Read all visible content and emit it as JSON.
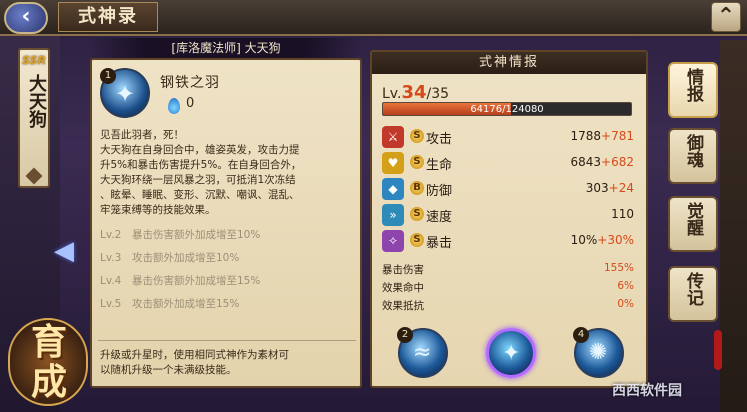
{
  "window": {
    "title": "式神录"
  },
  "nav": {
    "back_icon": "‹",
    "close_icon": "⌃"
  },
  "shikigami": {
    "rarity": "SSR",
    "name": "大天狗",
    "full_title": "[库洛魔法师] 大天狗"
  },
  "skill": {
    "level_badge": "1",
    "name": "钢铁之羽",
    "orb_cost": "0",
    "description": [
      "见吾此羽者，死！",
      "大天狗在自身回合中，雄姿英发，攻击力提",
      "升5%和暴击伤害提升5%。在自身回合外，",
      "大天狗环绕一层风暴之羽，可抵消1次冻结",
      "、眩晕、睡眠、变形、沉默、嘲讽、混乱、",
      "牢笼束缚等的技能效果。"
    ],
    "levels": [
      {
        "tag": "Lv.2",
        "text": "暴击伤害额外加成增至10%"
      },
      {
        "tag": "Lv.3",
        "text": "攻击额外加成增至10%"
      },
      {
        "tag": "Lv.4",
        "text": "暴击伤害额外加成增至15%"
      },
      {
        "tag": "Lv.5",
        "text": "攻击额外加成增至15%"
      }
    ],
    "note": [
      "升级或升星时，使用相同式神作为素材可",
      "以随机升级一个未满级技能。"
    ]
  },
  "info": {
    "header": "式神情报",
    "level_prefix": "Lv.",
    "level_current": "34",
    "level_max": "/35",
    "exp_text": "64176/124080",
    "exp_fraction": 0.517,
    "stats": [
      {
        "name": "攻击",
        "value": "1788",
        "bonus": "+781",
        "color": "#c0392b",
        "icon": "attack-icon"
      },
      {
        "name": "生命",
        "value": "6843",
        "bonus": "+682",
        "color": "#d4a017",
        "icon": "heart-icon"
      },
      {
        "name": "防御",
        "value": "303",
        "bonus": "+24",
        "color": "#2e86c1",
        "icon": "shield-icon"
      },
      {
        "name": "速度",
        "value": "110",
        "bonus": "",
        "color": "#2e8bb8",
        "icon": "boot-icon"
      },
      {
        "name": "暴击",
        "value": "10%",
        "bonus": "+30%",
        "color": "#8e44ad",
        "icon": "crit-icon"
      }
    ],
    "sub_stats": [
      {
        "name": "暴击伤害",
        "value": "155%"
      },
      {
        "name": "效果命中",
        "value": "6%"
      },
      {
        "name": "效果抵抗",
        "value": "0%"
      }
    ],
    "skill_slots": [
      {
        "num": "2",
        "selected": false
      },
      {
        "num": "",
        "selected": true
      },
      {
        "num": "4",
        "selected": false
      }
    ]
  },
  "tabs": [
    {
      "label": "情报",
      "active": true
    },
    {
      "label": "御魂",
      "active": false
    },
    {
      "label": "觉醒",
      "active": false
    },
    {
      "label": "传记",
      "active": false
    }
  ],
  "growth": {
    "label": "育成"
  },
  "watermark": "西西软件园"
}
